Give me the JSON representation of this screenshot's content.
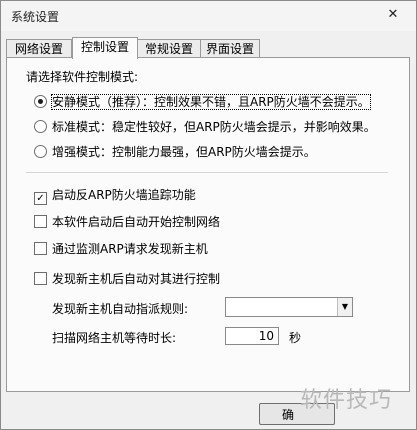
{
  "window": {
    "title": "系统设置",
    "close_glyph": "✕"
  },
  "tabs": [
    {
      "label": "网络设置"
    },
    {
      "label": "控制设置"
    },
    {
      "label": "常规设置"
    },
    {
      "label": "界面设置"
    }
  ],
  "active_tab": "控制设置",
  "control_mode": {
    "prompt": "请选择软件控制模式:",
    "options": [
      {
        "label": "安静模式（推荐）：控制效果不错，且ARP防火墙不会提示。",
        "checked": true
      },
      {
        "label": "标准模式：稳定性较好，但ARP防火墙会提示，并影响效果。",
        "checked": false
      },
      {
        "label": "增强模式：控制能力最强，但ARP防火墙会提示。",
        "checked": false
      }
    ]
  },
  "options": [
    {
      "label": "启动反ARP防火墙追踪功能",
      "checked": true
    },
    {
      "label": "本软件启动后自动开始控制网络",
      "checked": false
    },
    {
      "label": "通过监测ARP请求发现新主机",
      "checked": false
    },
    {
      "label": "发现新主机后自动对其进行控制",
      "checked": false
    }
  ],
  "auto_rule": {
    "label": "发现新主机自动指派规则:",
    "value": ""
  },
  "scan_wait": {
    "label": "扫描网络主机等待时长:",
    "value": "10",
    "unit": "秒"
  },
  "ok_button": {
    "label": "确"
  },
  "watermark": "软件技巧"
}
